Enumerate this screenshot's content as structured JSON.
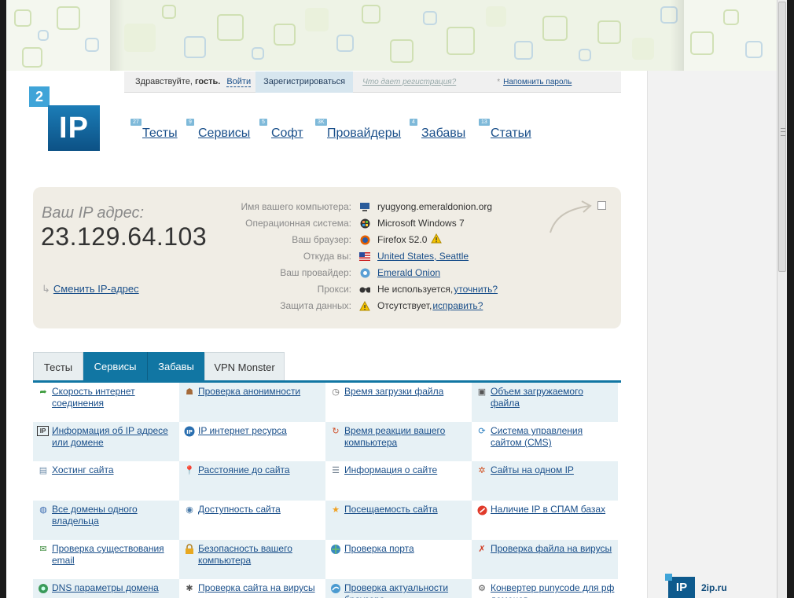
{
  "login_bar": {
    "greeting_prefix": "Здравствуйте,",
    "greeting_name": "гость.",
    "login": "Войти",
    "register": "Зарегистрироваться",
    "what_gives": "Что дает регистрация?",
    "star": "*",
    "remind_password": "Напомнить пароль"
  },
  "logo": {
    "digit": "2",
    "letters": "IP"
  },
  "nav": [
    {
      "badge": "27",
      "label": "Тесты"
    },
    {
      "badge": "9",
      "label": "Сервисы"
    },
    {
      "badge": "5",
      "label": "Софт"
    },
    {
      "badge": "3K",
      "label": "Провайдеры"
    },
    {
      "badge": "4",
      "label": "Забавы"
    },
    {
      "badge": "13",
      "label": "Статьи"
    }
  ],
  "ip_info": {
    "label": "Ваш IP адрес:",
    "value": "23.129.64.103",
    "change_link": "Сменить IP-адрес",
    "rows": [
      {
        "key": "Имя вашего компьютера:",
        "icon": "computer-icon",
        "value": "ryugyong.emeraldonion.org"
      },
      {
        "key": "Операционная система:",
        "icon": "windows-icon",
        "value": "Microsoft Windows 7"
      },
      {
        "key": "Ваш браузер:",
        "icon": "firefox-icon",
        "value": "Firefox 52.0"
      },
      {
        "key": "Откуда вы:",
        "icon": "us-flag-icon",
        "value": "United States, Seattle"
      },
      {
        "key": "Ваш провайдер:",
        "icon": "provider-icon",
        "value": "Emerald Onion"
      },
      {
        "key": "Прокси:",
        "icon": "glasses-icon",
        "value": "Не используется,",
        "link": "уточнить?"
      },
      {
        "key": "Защита данных:",
        "icon": "warning-icon",
        "value": "Отсутствует,",
        "link": "исправить?"
      }
    ]
  },
  "tabs": [
    "Тесты",
    "Сервисы",
    "Забавы",
    "VPN Monster"
  ],
  "services": [
    [
      "Скорость интернет соединения",
      "Проверка анонимности",
      "Время загрузки файла",
      "Объем загружаемого файла"
    ],
    [
      "Информация об IP адресе или домене",
      "IP интернет ресурса",
      "Время реакции вашего компьютера",
      "Система управления сайтом (CMS)"
    ],
    [
      "Хостинг сайта",
      "Расстояние до сайта",
      "Информация о сайте",
      "Сайты на одном IP"
    ],
    [
      "Все домены одного владельца",
      "Доступность сайта",
      "Посещаемость сайта",
      "Наличие IP в СПАМ базах"
    ],
    [
      "Проверка существования email",
      "Безопасность вашего компьютера",
      "Проверка порта",
      "Проверка файла на вирусы"
    ],
    [
      "DNS параметры домена",
      "Проверка сайта на вирусы",
      "Проверка актуальности браузера",
      "Конвертер punycode для рф доменов"
    ]
  ],
  "footer_logo": {
    "letters": "IP",
    "site": "2ip.ru"
  },
  "colors": {
    "accent": "#1176a3",
    "link": "#1a4f8a",
    "info_bg": "#f0ede5",
    "cell_shade": "#e7f1f5"
  }
}
